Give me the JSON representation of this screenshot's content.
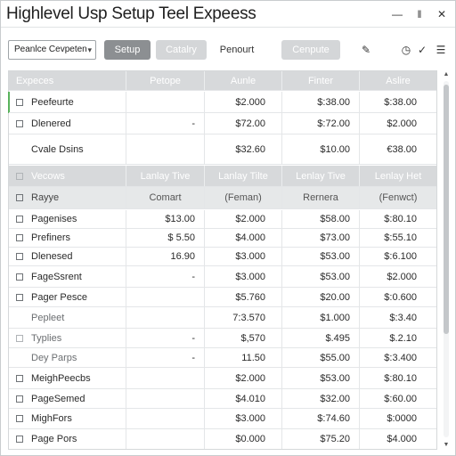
{
  "window": {
    "title": "Highlevel Usp Setup Teel Expeess",
    "min_glyph": "—",
    "max_glyph": "‖",
    "close_glyph": "✕"
  },
  "toolbar": {
    "select_value": "Peanlce Cevpeten",
    "select_caret": "▾",
    "setup_label": "Setup",
    "category_label": "Catalry",
    "percent_label": "Penourt",
    "compute_label": "Cenpute",
    "pencil_glyph": "✎",
    "clock_glyph": "◷",
    "check_glyph": "✓",
    "list_glyph": "☰"
  },
  "colors": {
    "accent": "#59b35c",
    "header_bg": "#d7d9db",
    "primary_button": "#8c8f92"
  },
  "table": {
    "columns": [
      "Expeces",
      "Petope",
      "Aunle",
      "Finter",
      "Aslire"
    ],
    "rows_a": [
      {
        "label": "Peefeurte",
        "c1": "",
        "c2": "$2.000",
        "c3": "$:38.00",
        "c4": "$:38.00"
      },
      {
        "label": "Dlenered",
        "c1": "-",
        "c2": "$72.00",
        "c3": "$:72.00",
        "c4": "$2.000"
      },
      {
        "label": "Cvale Dsins",
        "c1": "",
        "c2": "$32.60",
        "c3": "$10.00",
        "c4": "€38.00"
      }
    ],
    "group_header": [
      "Vecows",
      "Lanlay Tive",
      "Lanlay Tilte",
      "Lenlay Tive",
      "Lenlay Het"
    ],
    "sub_header": [
      "Rayye",
      "Comart",
      "(Feman)",
      "Rernera",
      "(Fenwct)"
    ],
    "rows_b": [
      {
        "label": "Pagenises",
        "c1": "$13.00",
        "c2": "$2.000",
        "c3": "$58.00",
        "c4": "$:80.10"
      },
      {
        "label": "Prefiners",
        "c1": "$ 5.50",
        "c2": "$4.000",
        "c3": "$73.00",
        "c4": "$:55.10"
      },
      {
        "label": "Dlenesed",
        "c1": "16.90",
        "c2": "$3.000",
        "c3": "$53.00",
        "c4": "$:6.100"
      },
      {
        "label": "FageSsrent",
        "c1": "-",
        "c2": "$3.000",
        "c3": "$53.00",
        "c4": "$2.000"
      },
      {
        "label": "Pager Pesce",
        "c1": "",
        "c2": "$5.760",
        "c3": "$20.00",
        "c4": "$:0.600"
      },
      {
        "label": "Pepleet",
        "c1": "",
        "c2": "7:3.570",
        "c3": "$1.000",
        "c4": "$:3.40"
      },
      {
        "label": "Typlies",
        "c1": "-",
        "c2": "$,570",
        "c3": "$.495",
        "c4": "$.2.10"
      },
      {
        "label": "Dey Parps",
        "c1": "-",
        "c2": "11.50",
        "c3": "$55.00",
        "c4": "$:3.400"
      },
      {
        "label": "MeighPeecbs",
        "c1": "",
        "c2": "$2.000",
        "c3": "$53.00",
        "c4": "$:80.10"
      },
      {
        "label": "PageSemed",
        "c1": "",
        "c2": "$4.010",
        "c3": "$32.00",
        "c4": "$:60.00"
      },
      {
        "label": "MighFors",
        "c1": "",
        "c2": "$3.000",
        "c3": "$:74.60",
        "c4": "$:0000"
      },
      {
        "label": "Page Pors",
        "c1": "",
        "c2": "$0.000",
        "c3": "$75.20",
        "c4": "$4.000"
      }
    ]
  },
  "scrollbar": {
    "up_glyph": "▲",
    "down_glyph": "▼"
  }
}
